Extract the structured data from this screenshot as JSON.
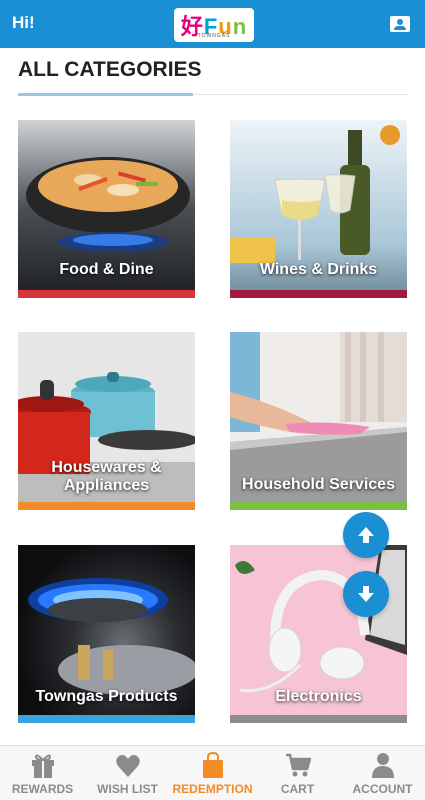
{
  "header": {
    "greeting": "Hi!",
    "logo_main": "好Fun",
    "logo_sub": "TOWNGAS"
  },
  "page": {
    "title": "ALL CATEGORIES"
  },
  "categories": [
    {
      "label": "Food & Dine",
      "stripe_color": "#d9343c"
    },
    {
      "label": "Wines & Drinks",
      "stripe_color": "#a3193e"
    },
    {
      "label": "Housewares & Appliances",
      "label_line1": "Housewares &",
      "label_line2": "Appliances",
      "stripe_color": "#f28c28"
    },
    {
      "label": "Household Services",
      "stripe_color": "#7ac143"
    },
    {
      "label": "Towngas Products",
      "stripe_color": "#39a4dd"
    },
    {
      "label": "Electronics",
      "stripe_color": "#8c8c8c"
    }
  ],
  "scroll": {
    "up_icon": "arrow-up-icon",
    "down_icon": "arrow-down-icon"
  },
  "tabs": [
    {
      "label": "REWARDS",
      "icon": "gift-icon",
      "active": false
    },
    {
      "label": "WISH LIST",
      "icon": "heart-icon",
      "active": false
    },
    {
      "label": "REDEMPTION",
      "icon": "shopping-bag-icon",
      "active": true
    },
    {
      "label": "CART",
      "icon": "cart-icon",
      "active": false
    },
    {
      "label": "ACCOUNT",
      "icon": "person-icon",
      "active": false
    }
  ],
  "colors": {
    "primary": "#1b8fd4",
    "active_tab": "#f28c28",
    "inactive_tab": "#8b8b8b"
  }
}
